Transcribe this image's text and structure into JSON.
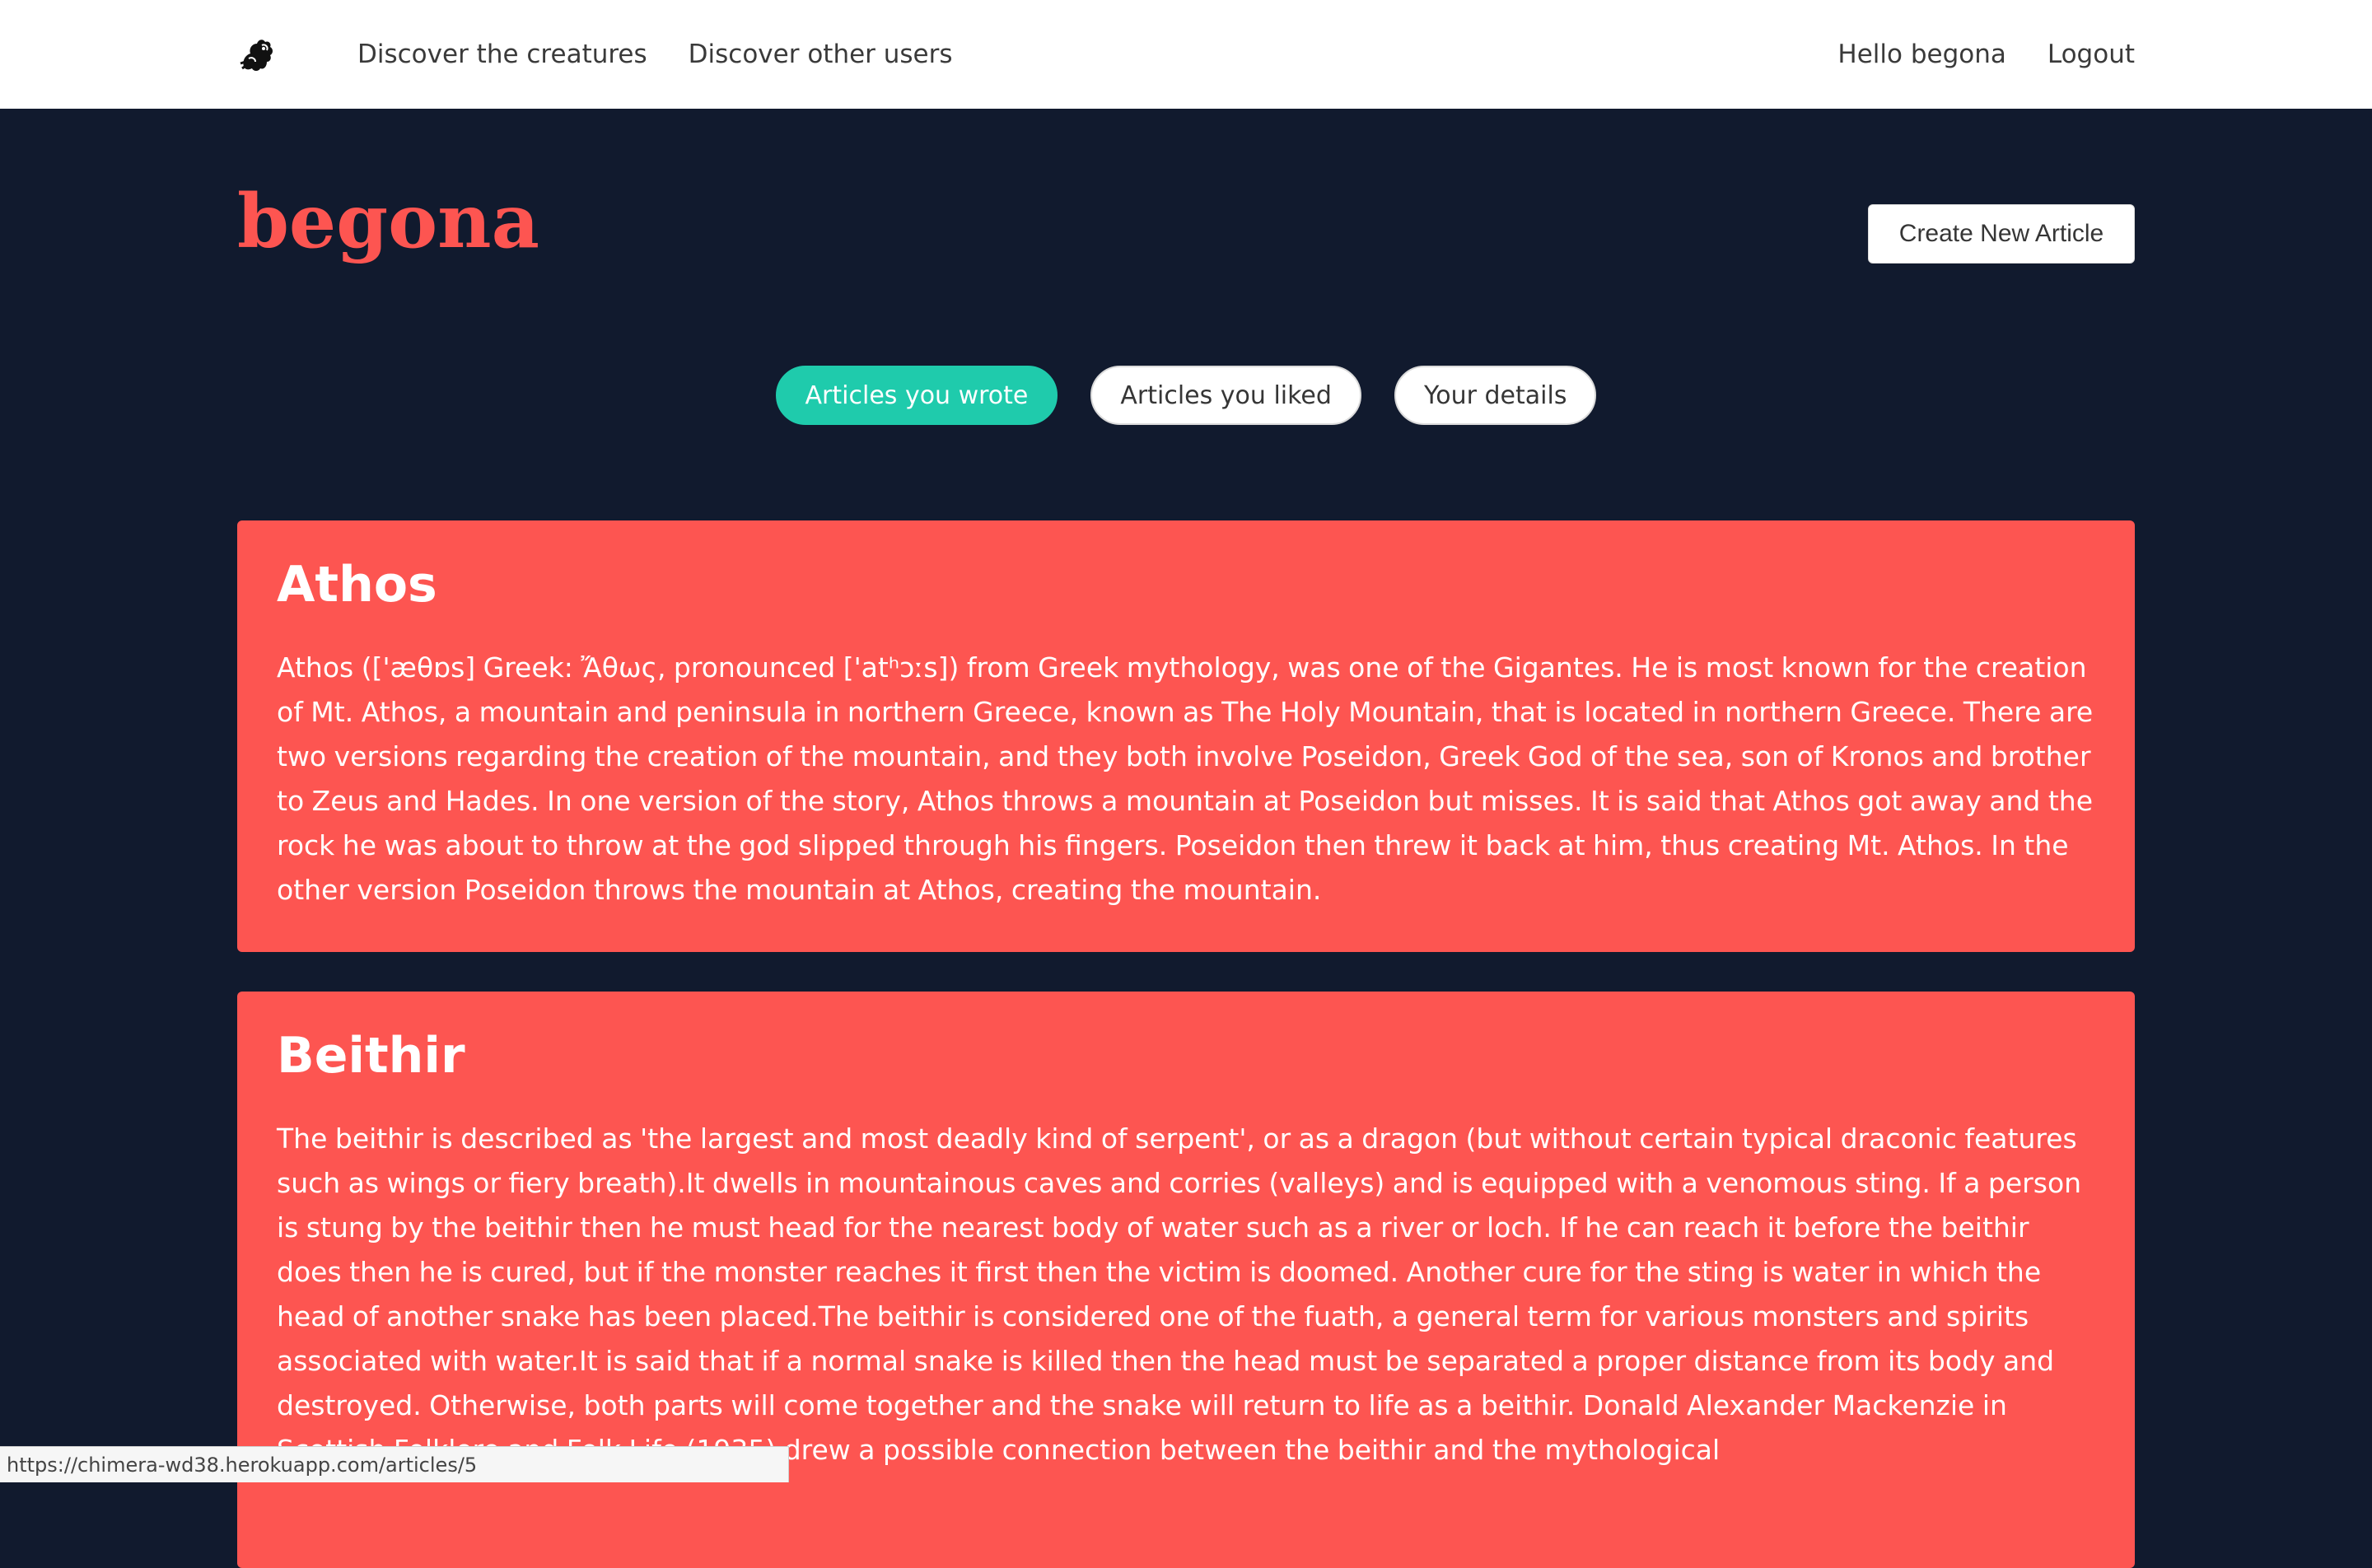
{
  "nav": {
    "logo_icon": "chimera-creature-icon",
    "links": [
      "Discover the creatures",
      "Discover other users"
    ],
    "greeting": "Hello begona",
    "logout": "Logout"
  },
  "profile": {
    "username": "begona",
    "create_button": "Create New Article"
  },
  "tabs": {
    "active_index": 0,
    "items": [
      "Articles you wrote",
      "Articles you liked",
      "Your details"
    ]
  },
  "articles": [
    {
      "title": "Athos",
      "body": "Athos (['æθɒs] Greek: Ἄθως, pronounced ['atʰɔːs]) from Greek mythology, was one of the Gigantes. He is most known for the creation of Mt. Athos, a mountain and peninsula in northern Greece, known as The Holy Mountain, that is located in northern Greece. There are two versions regarding the creation of the mountain, and they both involve Poseidon, Greek God of the sea, son of Kronos and brother to Zeus and Hades. In one version of the story, Athos throws a mountain at Poseidon but misses. It is said that Athos got away and the rock he was about to throw at the god slipped through his fingers. Poseidon then threw it back at him, thus creating Mt. Athos. In the other version Poseidon throws the mountain at Athos, creating the mountain."
    },
    {
      "title": "Beithir",
      "body": "The beithir is described as 'the largest and most deadly kind of serpent', or as a dragon (but without certain typical draconic features such as wings or fiery breath).It dwells in mountainous caves and corries (valleys) and is equipped with a venomous sting. If a person is stung by the beithir then he must head for the nearest body of water such as a river or loch. If he can reach it before the beithir does then he is cured, but if the monster reaches it first then the victim is doomed. Another cure for the sting is water in which the head of another snake has been placed.The beithir is considered one of the fuath, a general term for various monsters and spirits associated with water.It is said that if a normal snake is killed then the head must be separated a proper distance from its body and destroyed. Otherwise, both parts will come together and the snake will return to life as a beithir. Donald Alexander Mackenzie in Scottish Folklore and Folk Life (1935) drew a possible connection between the beithir and the mythological"
    }
  ],
  "status_bar": {
    "url": "https://chimera-wd38.herokuapp.com/articles/5"
  },
  "colors": {
    "background": "#111a2e",
    "accent": "#fd5551",
    "active_tab": "#1fcbac"
  }
}
